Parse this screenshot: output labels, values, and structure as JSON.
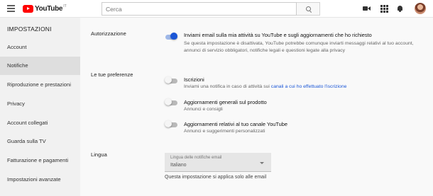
{
  "header": {
    "logo_text": "YouTube",
    "logo_region": "IT",
    "search_placeholder": "Cerca",
    "icons": [
      "menu-icon",
      "search-icon",
      "video-camera-icon",
      "apps-grid-icon",
      "bell-icon",
      "avatar"
    ]
  },
  "sidebar": {
    "title": "IMPOSTAZIONI",
    "items": [
      {
        "label": "Account",
        "active": false
      },
      {
        "label": "Notifiche",
        "active": true
      },
      {
        "label": "Riproduzione e prestazioni",
        "active": false
      },
      {
        "label": "Privacy",
        "active": false
      },
      {
        "label": "Account collegati",
        "active": false
      },
      {
        "label": "Guarda sulla TV",
        "active": false
      },
      {
        "label": "Fatturazione e pagamenti",
        "active": false
      },
      {
        "label": "Impostazioni avanzate",
        "active": false
      }
    ]
  },
  "main": {
    "authorization": {
      "label": "Autorizzazione",
      "title": "Inviami email sulla mia attività su YouTube e sugli aggiornamenti che ho richiesto",
      "desc_line1": "Se questa impostazione è disattivata, YouTube potrebbe comunque inviarti messaggi relativi al tuo account,",
      "desc_line2": "annunci di servizio obbligatori, notifiche legali e questioni legate alla privacy",
      "enabled": true
    },
    "preferences": {
      "label": "Le tue preferenze",
      "subscriptions": {
        "title": "Iscrizioni",
        "desc_prefix": "Inviami una notifica in caso di attività sui ",
        "desc_link": "canali a cui ho effettuato l'iscrizione",
        "enabled": false
      },
      "product_updates": {
        "title": "Aggiornamenti generali sul prodotto",
        "desc": "Annunci e consigli",
        "enabled": false
      },
      "channel_updates": {
        "title": "Aggiornamenti relativi al tuo canale YouTube",
        "desc": "Annunci e suggerimenti personalizzati",
        "enabled": false
      }
    },
    "language": {
      "label": "Lingua",
      "select_label": "Lingua delle notifiche email",
      "select_value": "Italiano",
      "helper": "Questa impostazione si applica solo alle email"
    }
  },
  "colors": {
    "accent": "#1a56d6",
    "logo_red": "#ff0000",
    "sidebar_bg": "#f1f1f1",
    "sidebar_active": "#dedede"
  }
}
